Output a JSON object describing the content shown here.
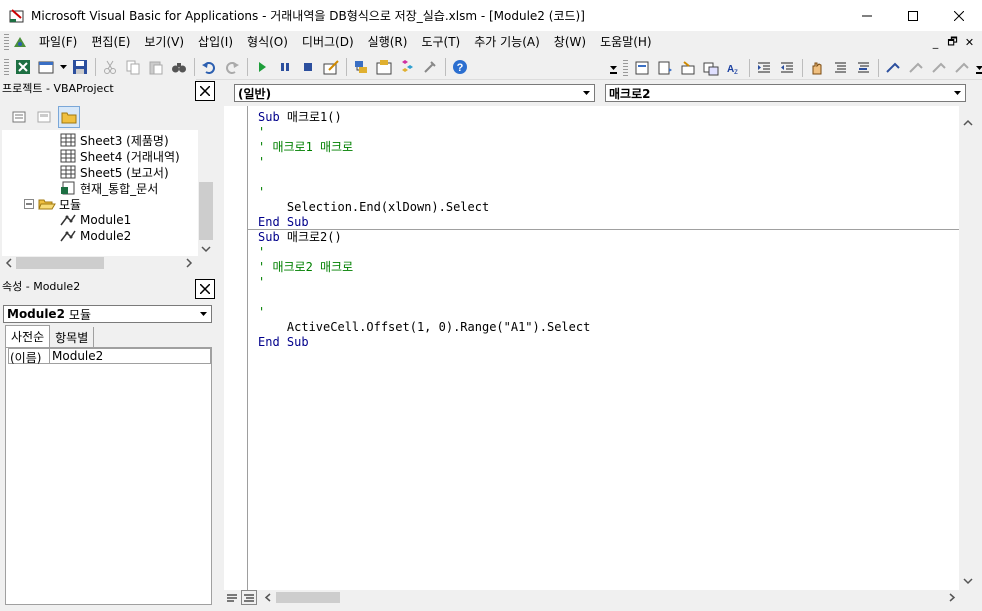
{
  "window": {
    "title": "Microsoft Visual Basic for Applications - 거래내역을 DB형식으로 저장_실습.xlsm - [Module2 (코드)]"
  },
  "menu": [
    "파일(F)",
    "편집(E)",
    "보기(V)",
    "삽입(I)",
    "형식(O)",
    "디버그(D)",
    "실행(R)",
    "도구(T)",
    "추가 기능(A)",
    "창(W)",
    "도움말(H)"
  ],
  "project": {
    "title": "프로젝트 - VBAProject",
    "nodes": [
      "Sheet3 (제품명)",
      "Sheet4 (거래내역)",
      "Sheet5 (보고서)",
      "현재_통합_문서",
      "모듈",
      "Module1",
      "Module2"
    ]
  },
  "properties": {
    "title": "속성 - Module2",
    "object_name": "Module2",
    "object_type": "모듈",
    "tabs": [
      "사전순",
      "항목별"
    ],
    "rows": [
      {
        "name": "(이름)",
        "value": "Module2"
      }
    ]
  },
  "editor": {
    "object_combo": "(일반)",
    "proc_combo": "매크로2",
    "lines": [
      {
        "text": "Sub 매크로1()",
        "kind": "kw"
      },
      {
        "text": "'",
        "kind": "cm"
      },
      {
        "text": "' 매크로1 매크로",
        "kind": "cm"
      },
      {
        "text": "'",
        "kind": "cm"
      },
      {
        "text": "",
        "kind": "plain"
      },
      {
        "text": "'",
        "kind": "cm"
      },
      {
        "text": "    Selection.End(xlDown).Select",
        "kind": "plain"
      },
      {
        "text": "End Sub",
        "kind": "kw"
      },
      {
        "text": "Sub 매크로2()",
        "kind": "kw"
      },
      {
        "text": "'",
        "kind": "cm"
      },
      {
        "text": "' 매크로2 매크로",
        "kind": "cm"
      },
      {
        "text": "'",
        "kind": "cm"
      },
      {
        "text": "",
        "kind": "plain"
      },
      {
        "text": "'",
        "kind": "cm"
      },
      {
        "text": "    ActiveCell.Offset(1, 0).Range(\"A1\").Select",
        "kind": "plain"
      },
      {
        "text": "End Sub",
        "kind": "kw"
      }
    ]
  }
}
